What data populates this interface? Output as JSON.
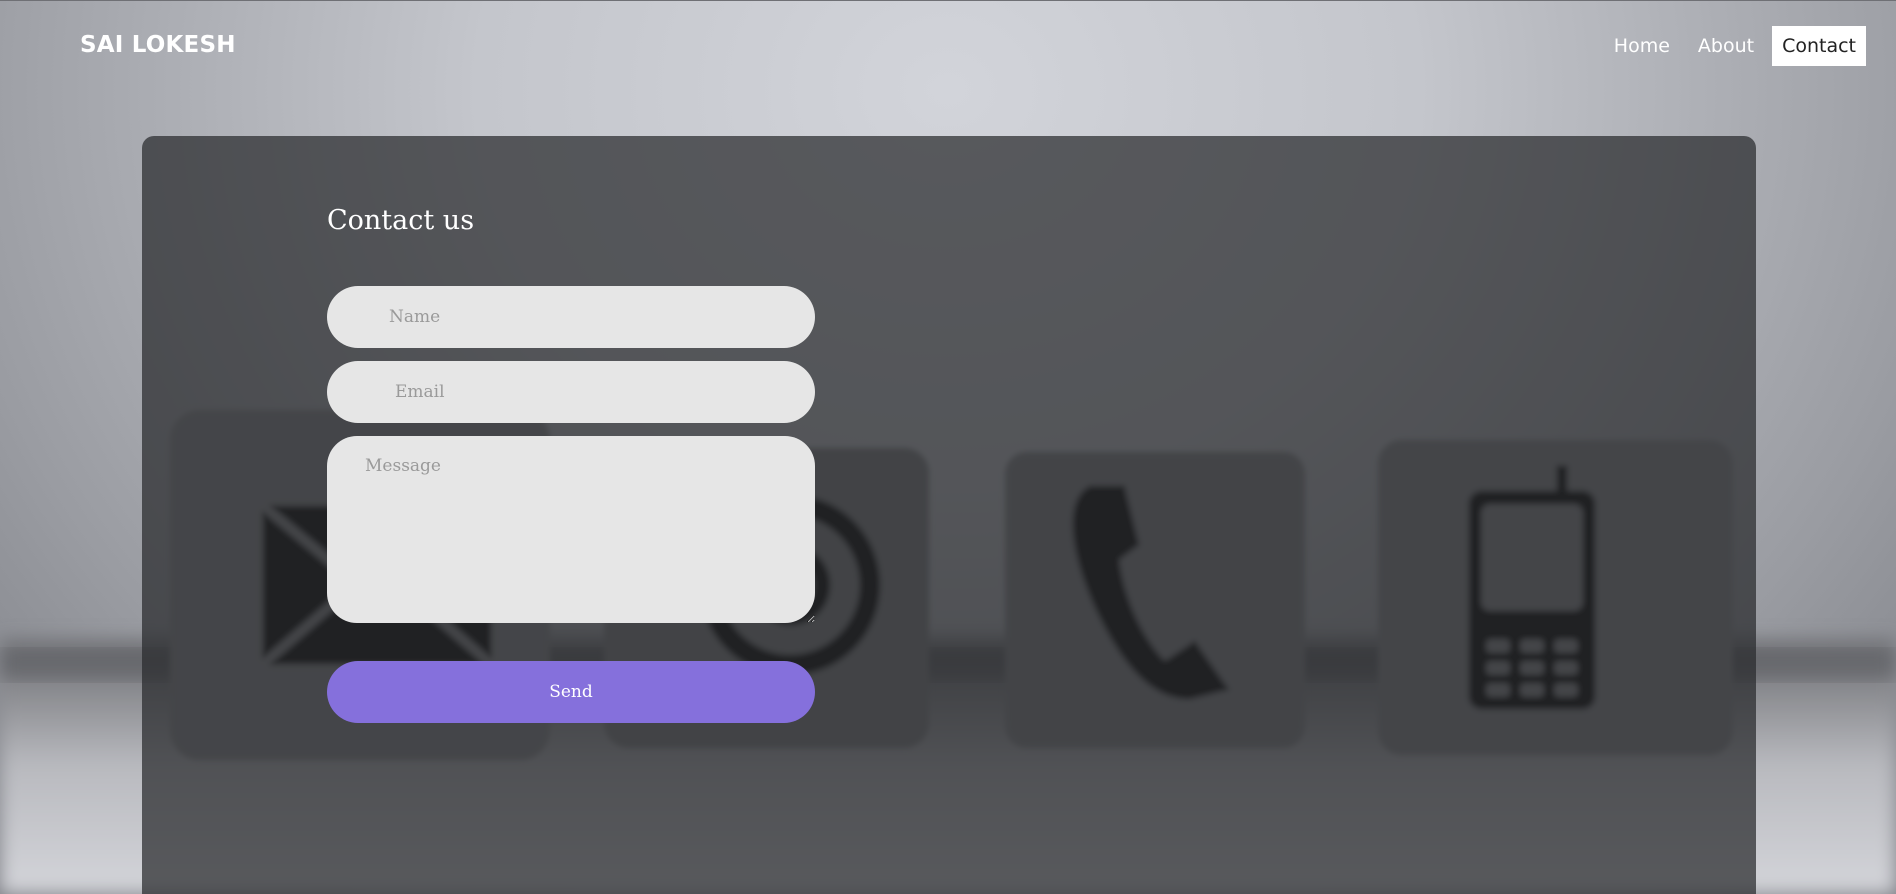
{
  "header": {
    "brand": "SAI LOKESH",
    "nav": [
      {
        "label": "Home",
        "active": false
      },
      {
        "label": "About",
        "active": false
      },
      {
        "label": "Contact",
        "active": true
      }
    ]
  },
  "contact_form": {
    "title": "Contact us",
    "name_placeholder": "Name",
    "email_placeholder": "Email",
    "message_placeholder": "Message",
    "send_label": "Send"
  },
  "background": {
    "icons": [
      "envelope-icon",
      "at-sign-icon",
      "phone-handset-icon",
      "mobile-phone-icon"
    ]
  },
  "colors": {
    "accent": "#8570dc",
    "input_bg": "#e6e6e6",
    "card_overlay": "#28292d"
  }
}
